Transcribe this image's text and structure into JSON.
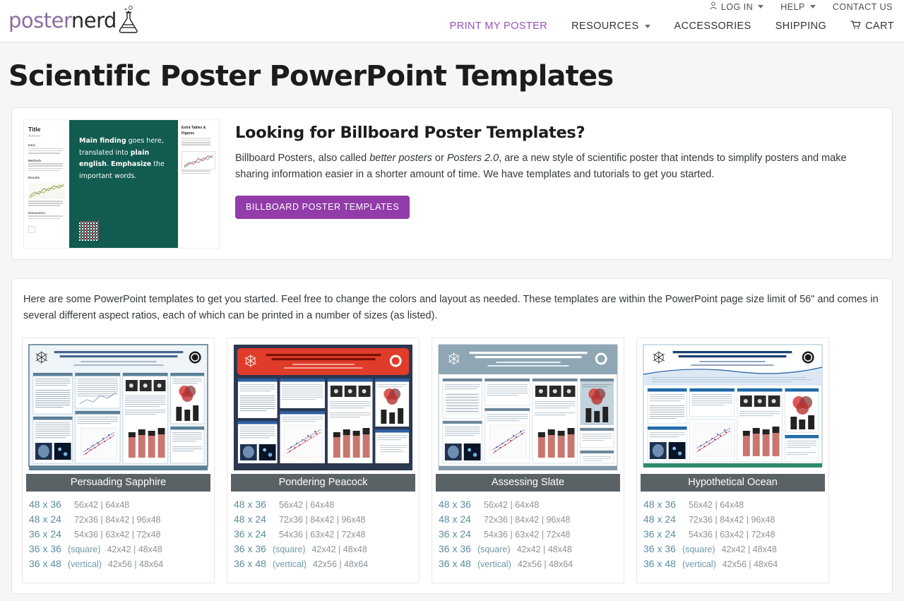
{
  "header": {
    "logo": {
      "part1": "poster",
      "part2": "nerd",
      "icon": "flask-icon"
    },
    "top_nav": [
      {
        "label": "LOG IN",
        "icon": "user-icon",
        "caret": true
      },
      {
        "label": "HELP",
        "caret": true
      },
      {
        "label": "CONTACT US",
        "caret": false
      }
    ],
    "main_nav": [
      {
        "label": "PRINT MY POSTER",
        "active": true,
        "caret": false
      },
      {
        "label": "RESOURCES",
        "active": false,
        "caret": true
      },
      {
        "label": "ACCESSORIES",
        "active": false,
        "caret": false
      },
      {
        "label": "SHIPPING",
        "active": false,
        "caret": false
      },
      {
        "label": "CART",
        "active": false,
        "caret": false,
        "icon": "cart-icon"
      }
    ]
  },
  "page": {
    "title": "Scientific Poster PowerPoint Templates"
  },
  "billboard": {
    "heading": "Looking for Billboard Poster Templates?",
    "paragraph_1": "Billboard Posters, also called ",
    "em_1": "better posters",
    "paragraph_2": " or ",
    "em_2": "Posters 2.0",
    "paragraph_3": ", are a new style of scientific poster that intends to simplify posters and make sharing information easier in a shorter amount of time. We have templates and tutorials to get you started.",
    "button_label": "BILLBOARD POSTER TEMPLATES",
    "thumbnail": {
      "title": "Title",
      "authors": "Authors",
      "sections": [
        "Intro",
        "Methods",
        "Results",
        "Discussion"
      ],
      "main_text_1": "Main finding",
      "main_text_2": " goes here, translated into ",
      "main_text_3": "plain english",
      "main_text_4": ". ",
      "main_text_5": "Emphasize",
      "main_text_6": " the important words.",
      "right_title": "Extra Tables & Figures",
      "qr": "qr-code"
    }
  },
  "templates": {
    "intro": "Here are some PowerPoint templates to get you started. Feel free to change the colors and layout as needed. These templates are within the PowerPoint page size limit of 56\" and comes in several different aspect ratios, each of which can be printed in a number of sizes (as listed).",
    "poster_header_line1": "This Scientific Poster Template Is Provided By PosterNerd",
    "poster_header_line2": "Enter A Title And Add Logos To Your Poster",
    "poster_header_line3": "Add Author Names and Information",
    "poster_header_line4": "Include University or Department Names if Needed",
    "cards": [
      {
        "name": "Persuading Sapphire",
        "theme": "sapphire",
        "sizes": [
          {
            "main": "48 x 36",
            "note": "",
            "alt": "56x42 | 64x48"
          },
          {
            "main": "48 x 24",
            "note": "",
            "alt": "72x36 | 84x42 | 96x48"
          },
          {
            "main": "36 x 24",
            "note": "",
            "alt": "54x36 | 63x42 | 72x48"
          },
          {
            "main": "36 x 36",
            "note": "(square)",
            "alt": "42x42 | 48x48"
          },
          {
            "main": "36 x 48",
            "note": "(vertical)",
            "alt": "42x56 | 48x64"
          }
        ]
      },
      {
        "name": "Pondering Peacock",
        "theme": "peacock",
        "sizes": [
          {
            "main": "48 x 36",
            "note": "",
            "alt": "56x42 | 64x48"
          },
          {
            "main": "48 x 24",
            "note": "",
            "alt": "72x36 | 84x42 | 96x48"
          },
          {
            "main": "36 x 24",
            "note": "",
            "alt": "54x36 | 63x42 | 72x48"
          },
          {
            "main": "36 x 36",
            "note": "(square)",
            "alt": "42x42 | 48x48"
          },
          {
            "main": "36 x 48",
            "note": "(vertical)",
            "alt": "42x56 | 48x64"
          }
        ]
      },
      {
        "name": "Assessing Slate",
        "theme": "slate",
        "sizes": [
          {
            "main": "48 x 36",
            "note": "",
            "alt": "56x42 | 64x48"
          },
          {
            "main": "48 x 24",
            "note": "",
            "alt": "72x36 | 84x42 | 96x48"
          },
          {
            "main": "36 x 24",
            "note": "",
            "alt": "54x36 | 63x42 | 72x48"
          },
          {
            "main": "36 x 36",
            "note": "(square)",
            "alt": "42x42 | 48x48"
          },
          {
            "main": "36 x 48",
            "note": "(vertical)",
            "alt": "42x56 | 48x64"
          }
        ]
      },
      {
        "name": "Hypothetical Ocean",
        "theme": "ocean",
        "sizes": [
          {
            "main": "48 x 36",
            "note": "",
            "alt": "56x42 | 64x48"
          },
          {
            "main": "48 x 24",
            "note": "",
            "alt": "72x36 | 84x42 | 96x48"
          },
          {
            "main": "36 x 24",
            "note": "",
            "alt": "54x36 | 63x42 | 72x48"
          },
          {
            "main": "36 x 36",
            "note": "(square)",
            "alt": "42x42 | 48x48"
          },
          {
            "main": "36 x 48",
            "note": "(vertical)",
            "alt": "42x56 | 48x64"
          }
        ]
      }
    ]
  },
  "colors": {
    "brand_purple": "#913ca8",
    "logo_purple": "#8e6ba1",
    "link_blue": "#5b8d9e",
    "card_title_gray": "#5b6266",
    "billboard_teal": "#125b51",
    "page_bg": "#f7f6f5"
  }
}
